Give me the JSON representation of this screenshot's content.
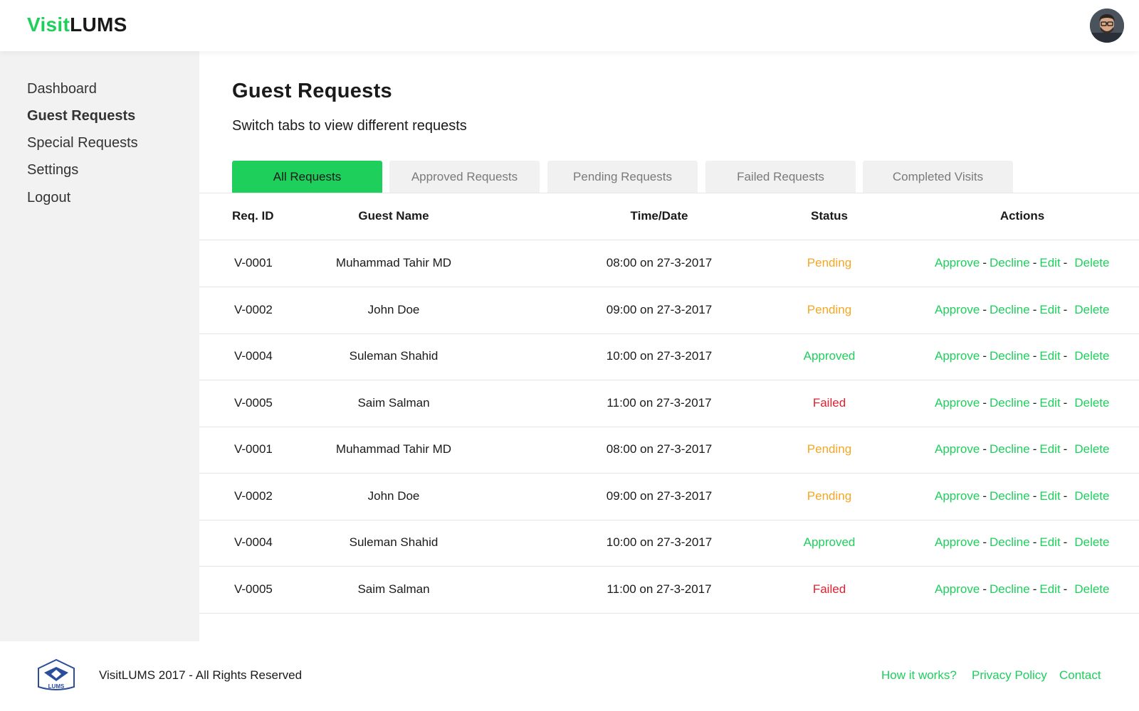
{
  "header": {
    "logo_part1": "Visit",
    "logo_part2": "LUMS",
    "avatar": "user-avatar"
  },
  "sidebar": {
    "items": [
      {
        "label": "Dashboard"
      },
      {
        "label": "Guest Requests",
        "active": true
      },
      {
        "label": "Special Requests"
      },
      {
        "label": "Settings"
      },
      {
        "label": "Logout"
      }
    ]
  },
  "main": {
    "title": "Guest Requests",
    "subtitle": "Switch tabs to view different requests",
    "tabs": [
      {
        "label": "All Requests",
        "active": true
      },
      {
        "label": "Approved Requests"
      },
      {
        "label": "Pending Requests"
      },
      {
        "label": "Failed Requests"
      },
      {
        "label": "Completed Visits"
      }
    ],
    "table": {
      "headers": [
        "Req. ID",
        "Guest Name",
        "Time/Date",
        "Status",
        "Actions"
      ],
      "rows": [
        {
          "id": "V-0001",
          "name": "Muhammad Tahir MD",
          "time": "08:00 on 27-3-2017",
          "status": "Pending"
        },
        {
          "id": "V-0002",
          "name": "John Doe",
          "time": "09:00 on 27-3-2017",
          "status": "Pending"
        },
        {
          "id": "V-0004",
          "name": "Suleman Shahid",
          "time": "10:00 on 27-3-2017",
          "status": "Approved"
        },
        {
          "id": "V-0005",
          "name": "Saim Salman",
          "time": "11:00 on 27-3-2017",
          "status": "Failed"
        },
        {
          "id": "V-0001",
          "name": "Muhammad Tahir MD",
          "time": "08:00 on 27-3-2017",
          "status": "Pending"
        },
        {
          "id": "V-0002",
          "name": "John Doe",
          "time": "09:00 on 27-3-2017",
          "status": "Pending"
        },
        {
          "id": "V-0004",
          "name": "Suleman Shahid",
          "time": "10:00 on 27-3-2017",
          "status": "Approved"
        },
        {
          "id": "V-0005",
          "name": "Saim Salman",
          "time": "11:00 on 27-3-2017",
          "status": "Failed"
        }
      ],
      "actions": {
        "approve": "Approve",
        "decline": "Decline",
        "edit": "Edit",
        "delete": "Delete",
        "separator": "-"
      }
    }
  },
  "footer": {
    "logo_icon": "lums-logo",
    "logo_text": "LUMS",
    "copyright": "VisitLUMS 2017 - All Rights Reserved",
    "links": [
      "How it works?",
      "Privacy Policy",
      "Contact"
    ]
  },
  "colors": {
    "accent": "#1ecf5c",
    "pending": "#f5a623",
    "failed": "#e0202f",
    "sidebar_bg": "#f2f2f2",
    "tab_bg": "#f1f1f1"
  }
}
